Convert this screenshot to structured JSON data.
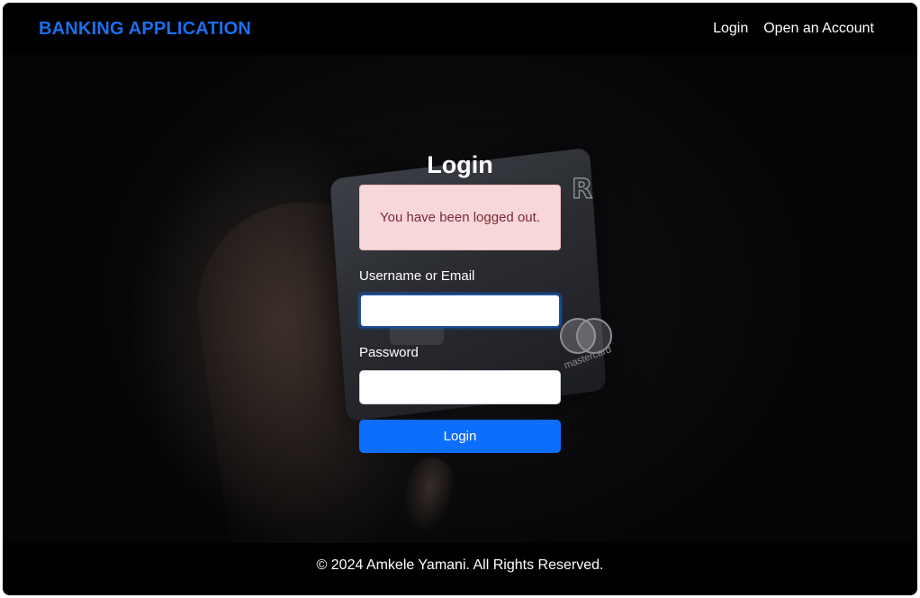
{
  "navbar": {
    "brand": "BANKING APPLICATION",
    "links": [
      "Login",
      "Open an Account"
    ]
  },
  "login_form": {
    "title": "Login",
    "alert_message": "You have been logged out.",
    "username_label": "Username or Email",
    "username_value": "",
    "password_label": "Password",
    "password_value": "",
    "submit_label": "Login"
  },
  "background": {
    "card_brand_letter": "R",
    "card_network": "mastercard"
  },
  "footer": {
    "text": "© 2024 Amkele Yamani. All Rights Reserved."
  },
  "colors": {
    "brand": "#1a6ff0",
    "primary_button": "#0d6efd",
    "alert_background": "#f8d7da",
    "alert_text": "#7a2a32",
    "navbar_background": "#000000"
  }
}
